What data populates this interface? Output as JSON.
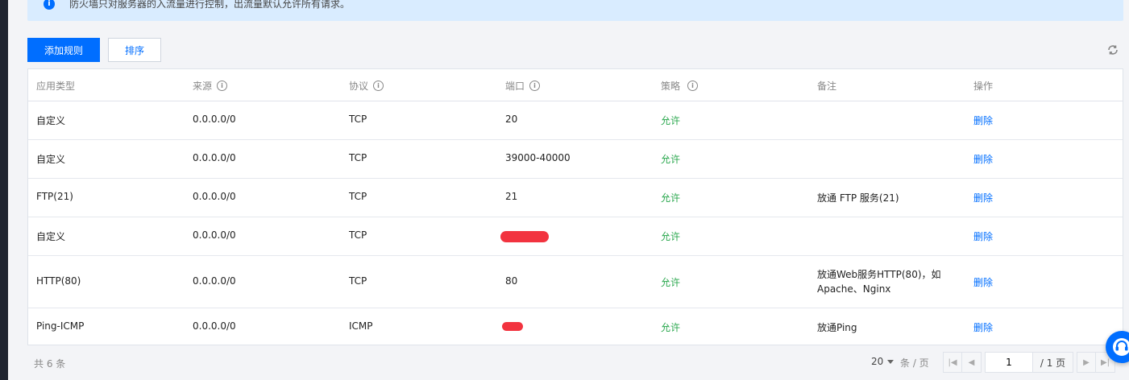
{
  "notice": {
    "text": "防火墙只对服务器的入流量进行控制，出流量默认允许所有请求。"
  },
  "toolbar": {
    "add_rule_label": "添加规则",
    "sort_label": "排序"
  },
  "table": {
    "headers": [
      "应用类型",
      "来源",
      "协议",
      "端口",
      "策略",
      "备注",
      "操作"
    ],
    "rows": [
      {
        "type": "自定义",
        "source": "0.0.0.0/0",
        "protocol": "TCP",
        "port": "20",
        "policy": "允许",
        "note": "",
        "action": "删除"
      },
      {
        "type": "自定义",
        "source": "0.0.0.0/0",
        "protocol": "TCP",
        "port": "39000-40000",
        "policy": "允许",
        "note": "",
        "action": "删除"
      },
      {
        "type": "FTP(21)",
        "source": "0.0.0.0/0",
        "protocol": "TCP",
        "port": "21",
        "policy": "允许",
        "note": "放通 FTP 服务(21)",
        "action": "删除"
      },
      {
        "type": "自定义",
        "source": "0.0.0.0/0",
        "protocol": "TCP",
        "port": "",
        "policy": "允许",
        "note": "",
        "action": "删除"
      },
      {
        "type": "HTTP(80)",
        "source": "0.0.0.0/0",
        "protocol": "TCP",
        "port": "80",
        "policy": "允许",
        "note_line1": "放通Web服务HTTP(80)，如",
        "note_line2": "Apache、Nginx",
        "action": "删除"
      },
      {
        "type": "Ping-ICMP",
        "source": "0.0.0.0/0",
        "protocol": "ICMP",
        "port": "",
        "policy": "允许",
        "note": "放通Ping",
        "action": "删除"
      }
    ]
  },
  "footer": {
    "total": "共 6 条",
    "page_size": "20",
    "per_page_label": "条 / 页",
    "current_page": "1",
    "total_pages": "/ 1 页"
  },
  "colors": {
    "primary": "#006eff",
    "allow": "#29a74d",
    "notice_bg": "#d9ecff"
  },
  "icons": [
    "info-icon",
    "refresh-icon",
    "help-chat-icon",
    "first-page-icon",
    "prev-page-icon",
    "next-page-icon",
    "last-page-icon"
  ]
}
